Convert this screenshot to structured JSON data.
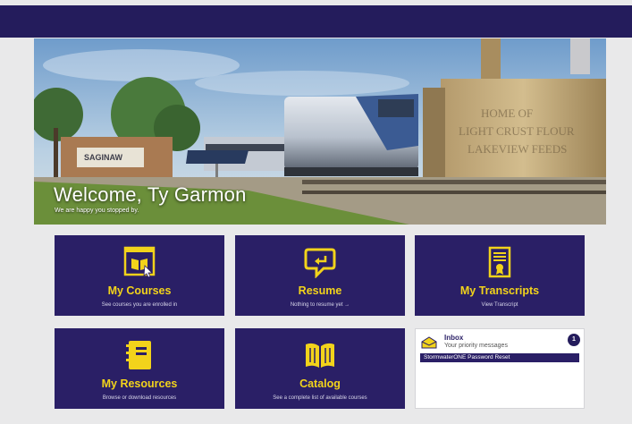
{
  "hero": {
    "welcome": "Welcome, Ty Garmon",
    "subtitle": "We are happy you stopped by."
  },
  "tiles": [
    {
      "title": "My Courses",
      "subtitle": "See courses you are enrolled in",
      "icon": "courses-icon"
    },
    {
      "title": "Resume",
      "subtitle": "Nothing to resume yet →",
      "icon": "resume-icon"
    },
    {
      "title": "My Transcripts",
      "subtitle": "View Transcript",
      "icon": "transcript-icon"
    },
    {
      "title": "My Resources",
      "subtitle": "Browse or download resources",
      "icon": "resources-icon"
    },
    {
      "title": "Catalog",
      "subtitle": "See a complete list of available courses",
      "icon": "catalog-icon"
    }
  ],
  "inbox": {
    "title": "Inbox",
    "subtitle": "Your priority messages",
    "count": "1",
    "messages": [
      "StormwaterONE Password Reset"
    ]
  },
  "colors": {
    "navy": "#241c5c",
    "tile": "#2a1f66",
    "accent": "#f2d31b",
    "background": "#e9e9ea"
  }
}
